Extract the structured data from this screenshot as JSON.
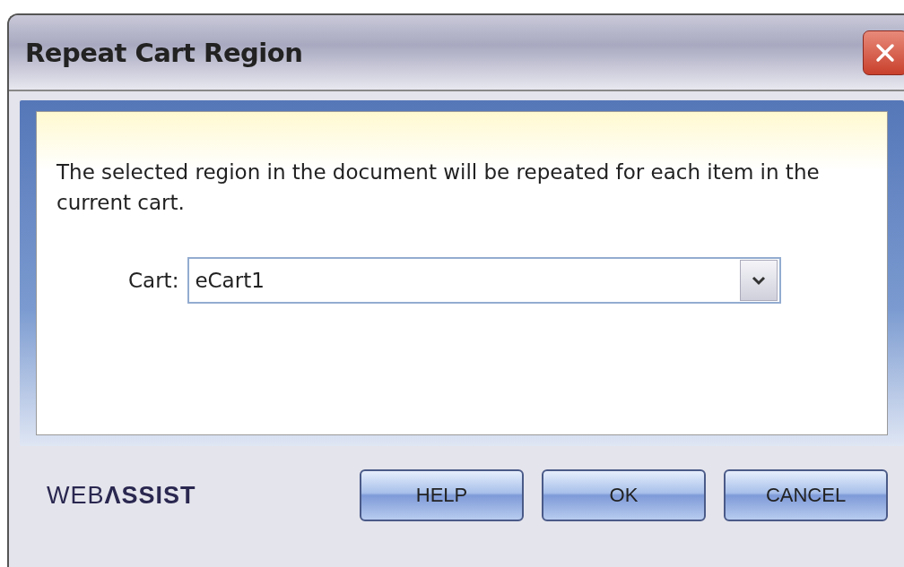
{
  "window": {
    "title": "Repeat Cart Region"
  },
  "message": "The selected region in the document will be repeated for each item in the current cart.",
  "cart_field": {
    "label": "Cart:",
    "value": "eCart1"
  },
  "logo": {
    "light": "WEB",
    "bold": "ΛSSIST"
  },
  "buttons": [
    {
      "label": "HELP"
    },
    {
      "label": "OK"
    },
    {
      "label": "CANCEL"
    }
  ]
}
